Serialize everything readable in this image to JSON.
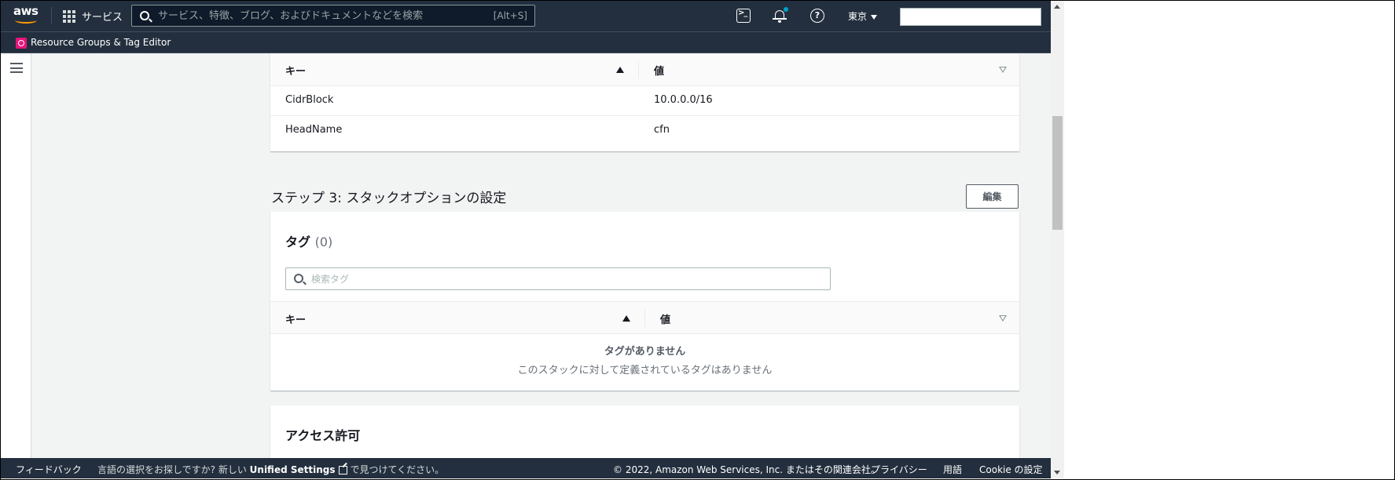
{
  "topnav": {
    "logo": "aws",
    "services_label": "サービス",
    "search_placeholder": "サービス、特徴、ブログ、およびドキュメントなどを検索",
    "search_shortcut": "[Alt+S]",
    "region": "東京",
    "notification_dot_color": "#00a1c9"
  },
  "subnav": {
    "label": "Resource Groups & Tag Editor"
  },
  "params_table": {
    "headers": {
      "key": "キー",
      "value": "値"
    },
    "rows": [
      {
        "key": "CidrBlock",
        "value": "10.0.0.0/16"
      },
      {
        "key": "HeadName",
        "value": "cfn"
      }
    ]
  },
  "step3": {
    "title": "ステップ 3: スタックオプションの設定",
    "edit_label": "編集"
  },
  "tags_card": {
    "title": "タグ",
    "count": "(0)",
    "search_placeholder": "検索タグ",
    "headers": {
      "key": "キー",
      "value": "値"
    },
    "empty_title": "タグがありません",
    "empty_desc": "このスタックに対して定義されているタグはありません"
  },
  "permissions_card": {
    "title": "アクセス許可"
  },
  "footer": {
    "feedback": "フィードバック",
    "lang_prompt": "言語の選択をお探しですか? 新しい",
    "unified_settings": "Unified Settings",
    "lang_suffix": "で見つけてください。",
    "copyright": "© 2022, Amazon Web Services, Inc. またはその関連会社。",
    "privacy": "プライバシー",
    "terms": "用語",
    "cookie": "Cookie の設定"
  }
}
